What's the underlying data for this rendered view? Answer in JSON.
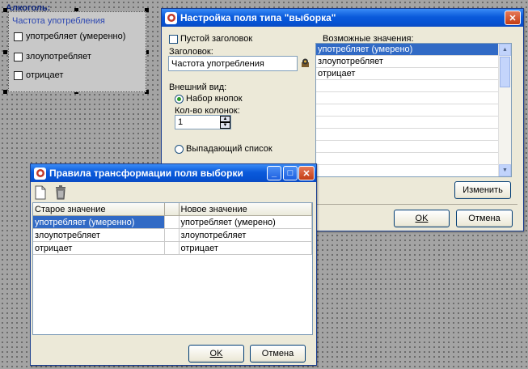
{
  "canvas": {
    "group_title": "Алкоголь:",
    "field_caption": "Частота употребления",
    "options": [
      "употребляет (умеренно)",
      "злоупотребляет",
      "отрицает"
    ]
  },
  "settings_dialog": {
    "title": "Настройка поля типа \"выборка\"",
    "empty_header_label": "Пустой заголовок",
    "header_label": "Заголовок:",
    "header_value": "Частота употребления",
    "appearance_label": "Внешний вид:",
    "radio_buttons_label": "Набор кнопок",
    "columns_label": "Кол-во колонок:",
    "columns_value": "1",
    "radio_dropdown_label": "Выпадающий список",
    "possible_values_label": "Возможные значения:",
    "possible_values": [
      "употребляет (умерено)",
      "злоупотребляет",
      "отрицает",
      "",
      "",
      "",
      "",
      "",
      "",
      ""
    ],
    "selected_index": 0,
    "change_button": "Изменить",
    "ok_button": "OK",
    "cancel_button": "Отмена"
  },
  "rules_dialog": {
    "title": "Правила трансформации поля выборки",
    "col_old": "Старое значение",
    "col_new": "Новое значение",
    "rows": [
      {
        "old": "употребляет (умеренно)",
        "new": "употребляет (умерено)"
      },
      {
        "old": "злоупотребляет",
        "new": "злоупотребляет"
      },
      {
        "old": "отрицает",
        "new": "отрицает"
      }
    ],
    "ok_button": "OK",
    "cancel_button": "Отмена"
  },
  "colors": {
    "titlebar": "#0a5adb",
    "selection": "#316ac5",
    "dialog_bg": "#ece9d8"
  },
  "icons": [
    "app-icon",
    "new-document-icon",
    "trash-icon",
    "edit-dictionary-icon",
    "close-icon",
    "minimize-icon",
    "maximize-icon",
    "spin-up-icon",
    "spin-down-icon"
  ]
}
